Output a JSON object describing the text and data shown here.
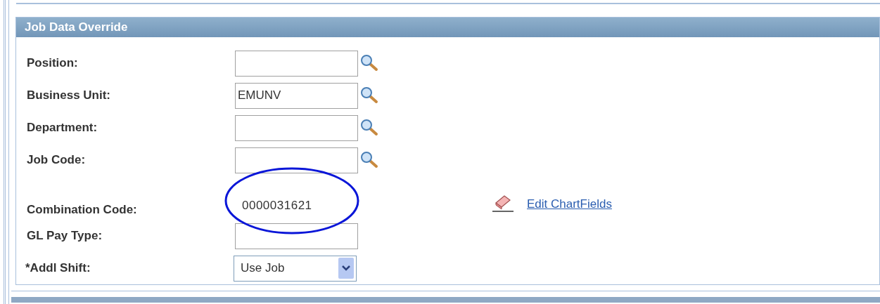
{
  "panel": {
    "title": "Job Data Override"
  },
  "fields": [
    {
      "kind": "lookup",
      "label": "Position:"
    },
    {
      "kind": "lookup",
      "label": "Business Unit:",
      "value": "EMUNV"
    },
    {
      "kind": "lookup",
      "label": "Department:"
    },
    {
      "kind": "lookup",
      "label": "Job Code:"
    },
    {
      "kind": "display",
      "label": "Combination Code:",
      "value": "0000031621",
      "circled": true
    },
    {
      "kind": "text",
      "label": "GL Pay Type:"
    },
    {
      "kind": "select",
      "label": "*Addl Shift:",
      "value": "Use Job"
    }
  ],
  "link": {
    "label": "Edit ChartFields"
  }
}
